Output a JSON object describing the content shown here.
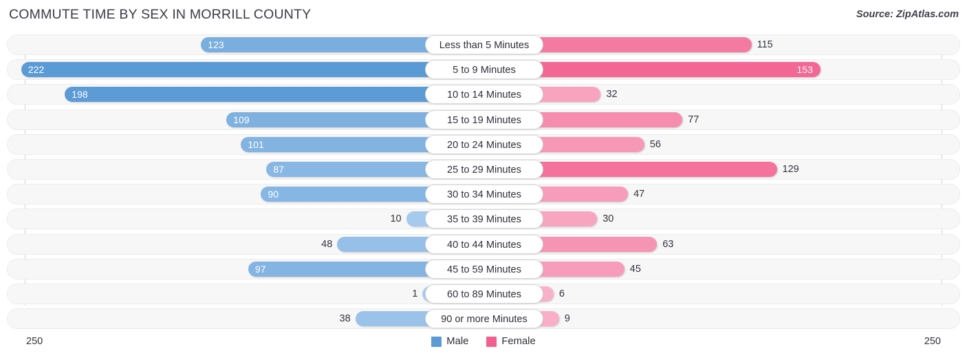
{
  "header": {
    "title": "COMMUTE TIME BY SEX IN MORRILL COUNTY",
    "source": "Source: ZipAtlas.com"
  },
  "axis": {
    "left_max_label": "250",
    "right_max_label": "250"
  },
  "legend": {
    "male_label": "Male",
    "female_label": "Female",
    "male_color": "#5b9bd5",
    "female_color": "#f2608f"
  },
  "chart_data": {
    "type": "bar",
    "subtype": "diverging-horizontal-bar",
    "title": "COMMUTE TIME BY SEX IN MORRILL COUNTY",
    "xlabel": "",
    "ylabel": "",
    "xlim": [
      250,
      250
    ],
    "axis_max": 250,
    "grid": false,
    "legend_position": "bottom-center",
    "categories": [
      "Less than 5 Minutes",
      "5 to 9 Minutes",
      "10 to 14 Minutes",
      "15 to 19 Minutes",
      "20 to 24 Minutes",
      "25 to 29 Minutes",
      "30 to 34 Minutes",
      "35 to 39 Minutes",
      "40 to 44 Minutes",
      "45 to 59 Minutes",
      "60 to 89 Minutes",
      "90 or more Minutes"
    ],
    "series": [
      {
        "name": "Male",
        "color": "#5b9bd5",
        "direction": "left",
        "values": [
          123,
          222,
          198,
          109,
          101,
          87,
          90,
          10,
          48,
          97,
          1,
          38
        ]
      },
      {
        "name": "Female",
        "color": "#f2608f",
        "direction": "right",
        "values": [
          115,
          153,
          32,
          77,
          56,
          129,
          47,
          30,
          63,
          45,
          6,
          9
        ]
      }
    ]
  },
  "rows": [
    {
      "category": "Less than 5 Minutes",
      "male": "123",
      "female": "115"
    },
    {
      "category": "5 to 9 Minutes",
      "male": "222",
      "female": "153"
    },
    {
      "category": "10 to 14 Minutes",
      "male": "198",
      "female": "32"
    },
    {
      "category": "15 to 19 Minutes",
      "male": "109",
      "female": "77"
    },
    {
      "category": "20 to 24 Minutes",
      "male": "101",
      "female": "56"
    },
    {
      "category": "25 to 29 Minutes",
      "male": "87",
      "female": "129"
    },
    {
      "category": "30 to 34 Minutes",
      "male": "90",
      "female": "47"
    },
    {
      "category": "35 to 39 Minutes",
      "male": "10",
      "female": "30"
    },
    {
      "category": "40 to 44 Minutes",
      "male": "48",
      "female": "63"
    },
    {
      "category": "45 to 59 Minutes",
      "male": "97",
      "female": "45"
    },
    {
      "category": "60 to 89 Minutes",
      "male": "1",
      "female": "6"
    },
    {
      "category": "90 or more Minutes",
      "male": "38",
      "female": "9"
    }
  ]
}
